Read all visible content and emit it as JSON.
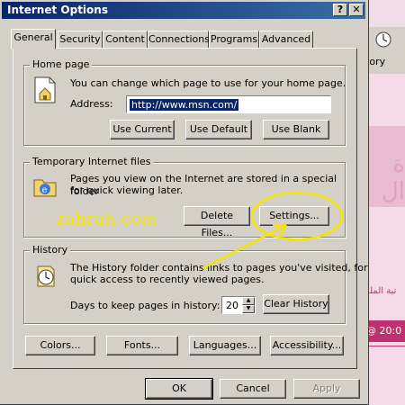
{
  "window": {
    "title": "Internet Options"
  },
  "title_buttons": {
    "help": "?",
    "close": "✕"
  },
  "tabs": [
    {
      "label": "General",
      "active": true
    },
    {
      "label": "Security",
      "active": false
    },
    {
      "label": "Content",
      "active": false
    },
    {
      "label": "Connections",
      "active": false
    },
    {
      "label": "Programs",
      "active": false
    },
    {
      "label": "Advanced",
      "active": false
    }
  ],
  "home_page": {
    "title": "Home page",
    "description": "You can change which page to use for your home page.",
    "address_label": "Address:",
    "address_value": "http://www.msn.com/",
    "use_current": "Use Current",
    "use_default": "Use Default",
    "use_blank": "Use Blank"
  },
  "temp_files": {
    "title": "Temporary Internet files",
    "description_line1": "Pages you view on the Internet are stored in a special folder",
    "description_line2": "for quick viewing later.",
    "delete_files": "Delete Files...",
    "settings": "Settings..."
  },
  "history": {
    "title": "History",
    "description_line1": "The History folder contains links to pages you've visited, for",
    "description_line2": "quick access to recently viewed pages.",
    "days_label": "Days to keep pages in history:",
    "days_value": "20",
    "clear_history": "Clear History"
  },
  "bottom_buttons": {
    "colors": "Colors...",
    "fonts": "Fonts...",
    "languages": "Languages...",
    "accessibility": "Accessibility..."
  },
  "dialog_buttons": {
    "ok": "OK",
    "cancel": "Cancel",
    "apply": "Apply"
  },
  "watermark": "zahrah.com",
  "background": {
    "toolbar_label": "tory",
    "arabic_big": "ة ال",
    "arabic_small": "تبة الملفا",
    "date_text": "@ 20:0"
  },
  "colors": {
    "titlebar": "#0a246a",
    "highlight": "#f6e300",
    "dialog": "#d4d0c8"
  }
}
